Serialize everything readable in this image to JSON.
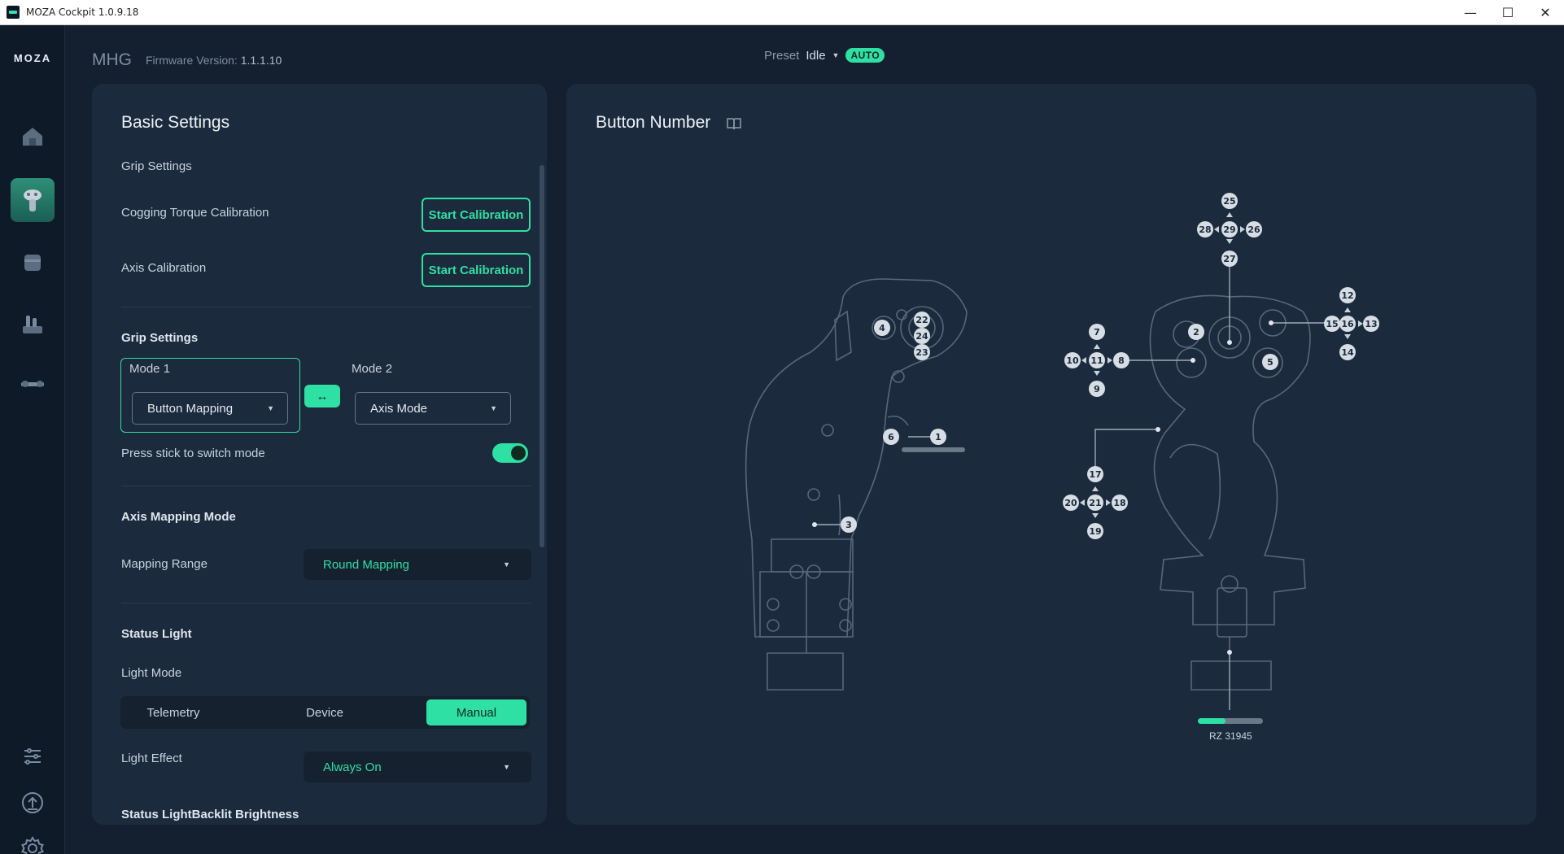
{
  "window": {
    "title": "MOZA Cockpit 1.0.9.18",
    "controls": {
      "minimize": "—",
      "maximize": "☐",
      "close": "✕"
    }
  },
  "sidebar": {
    "logo": "MOZA",
    "items": [
      {
        "name": "home",
        "icon": "home-icon"
      },
      {
        "name": "joystick",
        "icon": "joystick-icon",
        "active": true
      },
      {
        "name": "base",
        "icon": "base-icon"
      },
      {
        "name": "throttle",
        "icon": "throttle-icon"
      },
      {
        "name": "rudder",
        "icon": "rudder-icon"
      }
    ],
    "bottom": [
      {
        "name": "tuning",
        "icon": "sliders-icon"
      },
      {
        "name": "update",
        "icon": "upload-icon"
      },
      {
        "name": "settings",
        "icon": "gear-icon"
      }
    ]
  },
  "header": {
    "device": "MHG",
    "firmware_label": "Firmware Version:",
    "firmware_value": "1.1.1.10",
    "preset_label": "Preset",
    "preset_value": "Idle",
    "auto_badge": "AUTO"
  },
  "basic_settings": {
    "title": "Basic Settings",
    "grip_settings_1": "Grip Settings",
    "cogging_label": "Cogging Torque Calibration",
    "cogging_button": "Start Calibration",
    "axis_cal_label": "Axis Calibration",
    "axis_cal_button": "Start Calibration",
    "grip_settings_2": "Grip Settings",
    "mode1_label": "Mode 1",
    "mode1_value": "Button Mapping",
    "swap_label": "↔",
    "mode2_label": "Mode 2",
    "mode2_value": "Axis Mode",
    "press_stick_label": "Press stick to switch mode",
    "press_stick_enabled": true,
    "axis_mapping_head": "Axis Mapping Mode",
    "mapping_range_label": "Mapping Range",
    "mapping_range_value": "Round Mapping",
    "status_light_head": "Status Light",
    "light_mode_label": "Light Mode",
    "light_mode_options": [
      "Telemetry",
      "Device",
      "Manual"
    ],
    "light_mode_selected": "Manual",
    "light_effect_label": "Light Effect",
    "light_effect_value": "Always On",
    "backlit_label": "Status LightBacklit Brightness"
  },
  "button_number": {
    "title": "Button Number",
    "rz_label": "RZ 31945",
    "rz_fraction": 0.42,
    "colors": {
      "accent": "#2ee0a3",
      "badge": "#d7dde4",
      "line": "#7f8da0"
    }
  }
}
